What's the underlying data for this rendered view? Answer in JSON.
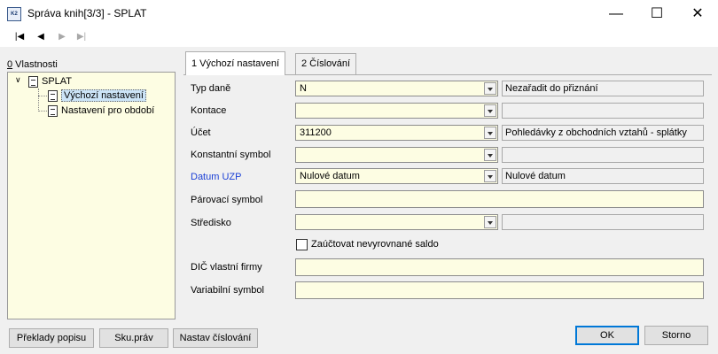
{
  "window": {
    "title": "Správa knih[3/3] - SPLAT",
    "icon_text": "K2"
  },
  "titlebar_controls": {
    "minimize": "—",
    "maximize": "☐",
    "close": "✕"
  },
  "navigation": {
    "first": "|◀",
    "prev": "◀",
    "next": "▶",
    "last": "▶|"
  },
  "left_panel": {
    "label_prefix": "0",
    "label_rest": " Vlastnosti",
    "tree": {
      "root": "SPLAT",
      "children": [
        "Výchozí nastavení",
        "Nastavení pro období"
      ]
    }
  },
  "tabs": [
    "1 Výchozí nastavení",
    "2 Číslování"
  ],
  "form": {
    "typ_dane": {
      "label": "Typ daně",
      "value": "N",
      "desc": "Nezařadit do přiznání"
    },
    "kontace": {
      "label": "Kontace",
      "value": "",
      "desc": ""
    },
    "ucet": {
      "label": "Účet",
      "value": "311200",
      "desc": "Pohledávky z obchodních vztahů - splátky"
    },
    "konstantni_symbol": {
      "label": "Konstantní symbol",
      "value": "",
      "desc": ""
    },
    "datum_uzp": {
      "label": "Datum UZP",
      "value": "Nulové datum",
      "desc": "Nulové datum"
    },
    "parovaci_symbol": {
      "label": "Párovací symbol",
      "value": ""
    },
    "stredisko": {
      "label": "Středisko",
      "value": "",
      "desc": ""
    },
    "zauctovat": {
      "label": "Zaúčtovat nevyrovnané saldo",
      "checked": false
    },
    "dic": {
      "label": "DIČ vlastní firmy",
      "value": ""
    },
    "variabilni_symbol": {
      "label": "Variabilní symbol",
      "value": ""
    }
  },
  "buttons": {
    "preklady_popisu": "Překlady popisu",
    "sku_prav": "Sku.práv",
    "nastav_cislovani": "Nastav číslování",
    "ok": "OK",
    "storno": "Storno"
  },
  "colors": {
    "field_bg": "#fdfde3",
    "tree_bg": "#fdfde3",
    "label_blue": "#1a3fd6",
    "default_border": "#0078d7"
  }
}
